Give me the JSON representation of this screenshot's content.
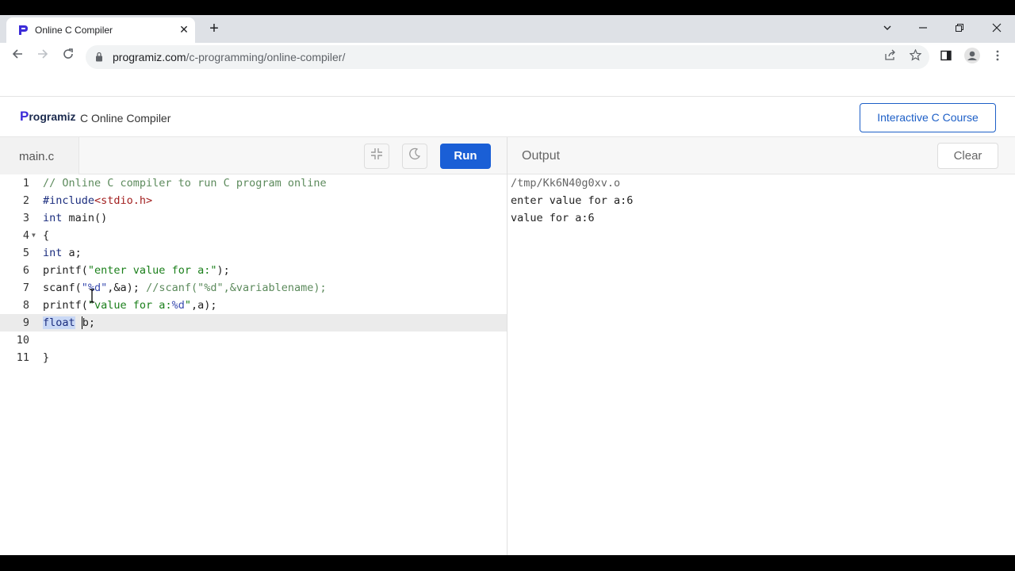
{
  "browser": {
    "tab_title": "Online C Compiler",
    "tab_close": "✕",
    "new_tab": "+",
    "url_host": "programiz.com",
    "url_path": "/c-programming/online-compiler/"
  },
  "site": {
    "logo_p": "P",
    "logo_rest": "rogramiz",
    "title": "C Online Compiler",
    "course_button": "Interactive C Course"
  },
  "editor": {
    "file_name": "main.c",
    "run_label": "Run",
    "lines": [
      {
        "num": "1"
      },
      {
        "num": "2"
      },
      {
        "num": "3"
      },
      {
        "num": "4"
      },
      {
        "num": "5"
      },
      {
        "num": "6"
      },
      {
        "num": "7"
      },
      {
        "num": "8"
      },
      {
        "num": "9"
      },
      {
        "num": "10"
      },
      {
        "num": "11"
      }
    ],
    "code": {
      "l1": "// Online C compiler to run C program online",
      "l2_inc": "#include",
      "l2_hdr": "<stdio.h>",
      "l3_kw": "int",
      "l3_rest": " main()",
      "l4": "{",
      "l5_kw": "int",
      "l5_rest": " a;",
      "l6_a": "printf(",
      "l6_str": "\"enter value for a:\"",
      "l6_b": ");",
      "l7_a": "scanf(",
      "l7_fmt": "\"%d\"",
      "l7_b": ",&a); ",
      "l7_cm": "//scanf(\"%d\",&variablename);",
      "l8_a": "printf(",
      "l8_str": "\"value for a:",
      "l8_fmt": "%d",
      "l8_str2": "\"",
      "l8_b": ",a);",
      "l9_kw": "float",
      "l9_sp": " ",
      "l9_rest": "b;",
      "l11": "}"
    }
  },
  "output": {
    "title": "Output",
    "clear_label": "Clear",
    "lines": [
      "/tmp/Kk6N40g0xv.o",
      "enter value for a:6",
      "value for a:6"
    ]
  }
}
